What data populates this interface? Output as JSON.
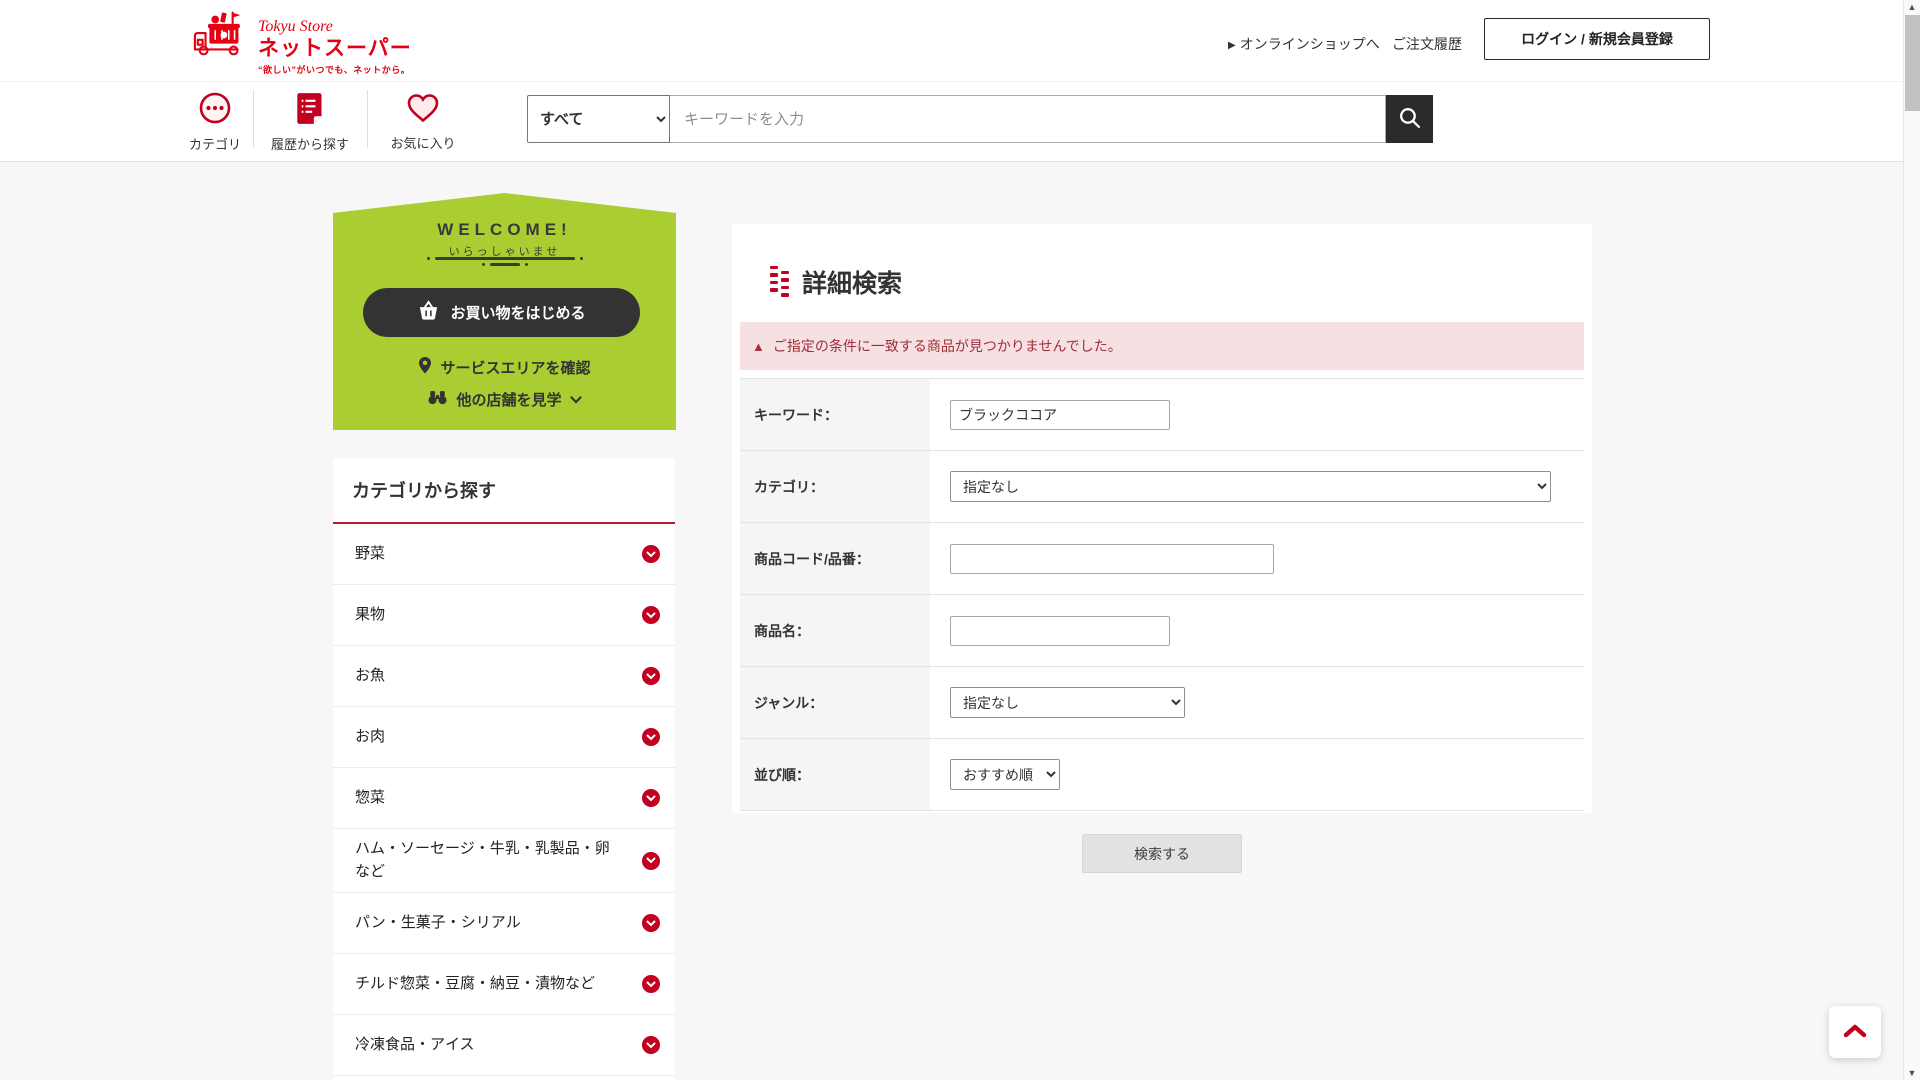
{
  "header": {
    "logo": {
      "brand_script": "Tokyu Store",
      "brand_main": "ネットスーパー",
      "tagline": "“欲しい”がいつでも、ネットから。"
    },
    "online_shop_marker": "▶",
    "online_shop_link": "オンラインショップへ",
    "order_history_link": "ご注文履歴",
    "login_button": "ログイン / 新規会員登録"
  },
  "subheader": {
    "nav_category": "カテゴリ",
    "nav_history": "履歴から探す",
    "nav_favorites": "お気に入り",
    "search_scope": "すべて",
    "search_placeholder": "キーワードを入力"
  },
  "welcome": {
    "title": "WELCOME!",
    "subtitle": "いらっしゃいませ",
    "start_shopping": "お買い物をはじめる",
    "check_service_area": "サービスエリアを確認",
    "view_other_stores": "他の店舗を見学"
  },
  "categories": {
    "title": "カテゴリから探す",
    "items": [
      "野菜",
      "果物",
      "お魚",
      "お肉",
      "惣菜",
      "ハム・ソーセージ・牛乳・乳製品・卵など",
      "パン・生菓子・シリアル",
      "チルド惣菜・豆腐・納豆・漬物など",
      "冷凍食品・アイス"
    ]
  },
  "detail_search": {
    "title": "詳細検索",
    "error_message": "ご指定の条件に一致する商品が見つかりませんでした。",
    "keyword_label": "キーワード：",
    "keyword_value": "ブラックココア",
    "category_label": "カテゴリ：",
    "category_value": "指定なし",
    "product_code_label": "商品コード/品番：",
    "product_code_value": "",
    "product_name_label": "商品名：",
    "product_name_value": "",
    "genre_label": "ジャンル：",
    "genre_value": "指定なし",
    "sort_label": "並び順：",
    "sort_value": "おすすめ順",
    "submit_button": "検索する"
  },
  "misc": {
    "warning_triangle": "▲",
    "scroll_up_arrow": "▲",
    "scroll_down_arrow": "▼"
  },
  "colors": {
    "brand_red": "#e60012",
    "accent_red": "#c2001f",
    "welcome_green": "#aacd32",
    "dark_button": "#333333",
    "error_bg": "#f6e0e2",
    "error_text": "#9d3039",
    "search_button_bg": "#2b2b2b"
  }
}
